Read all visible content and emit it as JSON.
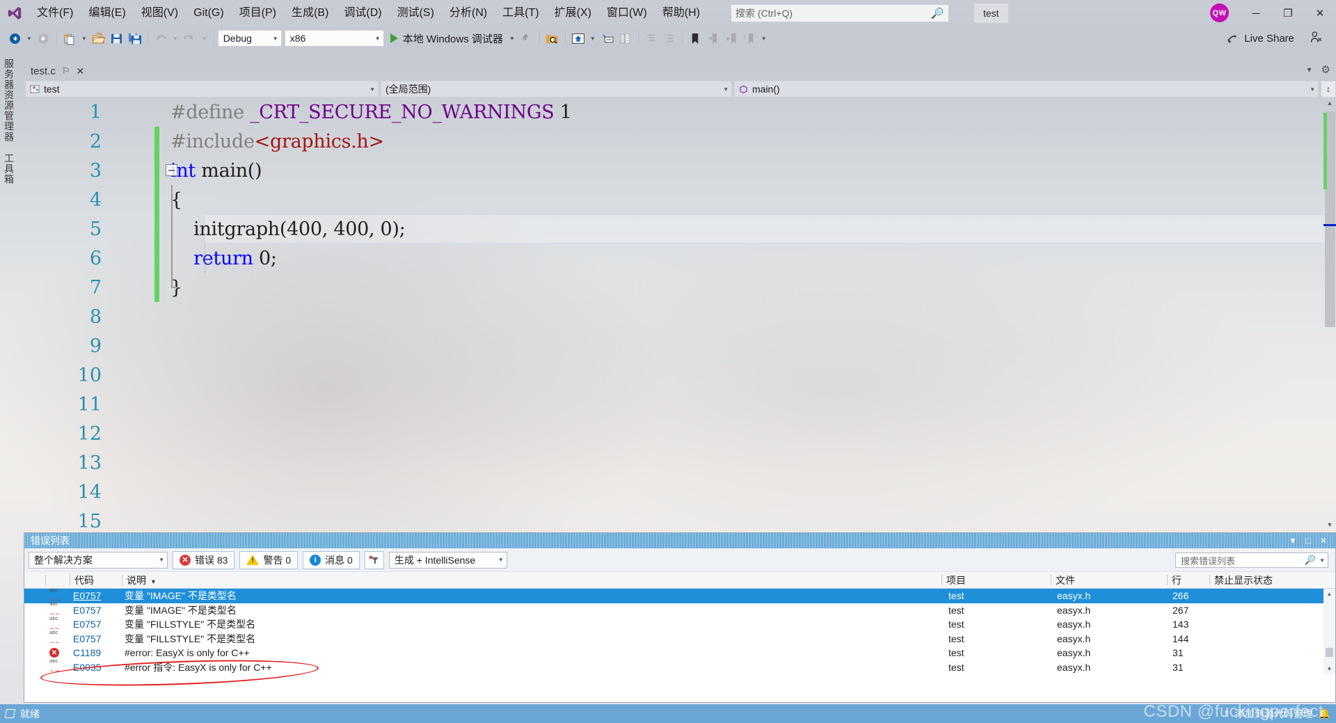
{
  "window": {
    "menu": [
      {
        "label": "文件(F)"
      },
      {
        "label": "编辑(E)"
      },
      {
        "label": "视图(V)"
      },
      {
        "label": "Git(G)"
      },
      {
        "label": "项目(P)"
      },
      {
        "label": "生成(B)"
      },
      {
        "label": "调试(D)"
      },
      {
        "label": "测试(S)"
      },
      {
        "label": "分析(N)"
      },
      {
        "label": "工具(T)"
      },
      {
        "label": "扩展(X)"
      },
      {
        "label": "窗口(W)"
      },
      {
        "label": "帮助(H)"
      }
    ],
    "search_placeholder": "搜索 (Ctrl+Q)",
    "solution_name": "test",
    "avatar_initials": "QW",
    "minimize": "─",
    "restore": "❐",
    "close": "✕"
  },
  "toolbar": {
    "config": "Debug",
    "platform": "x86",
    "run_label": "本地 Windows 调试器",
    "live_share": "Live Share"
  },
  "leftrail": {
    "server_explorer": "服务器资源管理器",
    "toolbox": "工具箱"
  },
  "tabstrip": {
    "document": "test.c",
    "pin_icon": "⚐",
    "close_icon": "✕",
    "overflow_icon": "▾",
    "settings_icon": "⚙"
  },
  "navbar": {
    "project_scope": "test",
    "member_scope": "(全局范围)",
    "function_scope": "main()"
  },
  "editor": {
    "lines": [
      {
        "no": "1",
        "changed": false,
        "tokens": [
          {
            "t": "#define ",
            "c": "k-pp"
          },
          {
            "t": "_CRT_SECURE_NO_WARNINGS",
            "c": "k-macro"
          },
          {
            "t": " 1",
            "c": "k-plain"
          }
        ]
      },
      {
        "no": "2",
        "changed": true,
        "tokens": [
          {
            "t": "#include",
            "c": "k-pp"
          },
          {
            "t": "<graphics.h>",
            "c": "k-str"
          }
        ]
      },
      {
        "no": "3",
        "changed": true,
        "tokens": [
          {
            "t": "int",
            "c": "k-kw"
          },
          {
            "t": " main()",
            "c": "k-plain"
          }
        ]
      },
      {
        "no": "4",
        "changed": true,
        "tokens": [
          {
            "t": "{",
            "c": "k-plain"
          }
        ]
      },
      {
        "no": "5",
        "changed": true,
        "tokens": [
          {
            "t": "    initgraph(400, 400, 0);",
            "c": "k-plain"
          }
        ]
      },
      {
        "no": "6",
        "changed": true,
        "tokens": [
          {
            "t": "    ",
            "c": "k-plain"
          },
          {
            "t": "return",
            "c": "k-kw"
          },
          {
            "t": " 0;",
            "c": "k-plain"
          }
        ]
      },
      {
        "no": "7",
        "changed": true,
        "tokens": [
          {
            "t": "}",
            "c": "k-plain"
          }
        ]
      },
      {
        "no": "8",
        "changed": false,
        "tokens": []
      },
      {
        "no": "9",
        "changed": false,
        "tokens": []
      },
      {
        "no": "10",
        "changed": false,
        "tokens": []
      },
      {
        "no": "11",
        "changed": false,
        "tokens": []
      },
      {
        "no": "12",
        "changed": false,
        "tokens": []
      },
      {
        "no": "13",
        "changed": false,
        "tokens": []
      },
      {
        "no": "14",
        "changed": false,
        "tokens": []
      },
      {
        "no": "15",
        "changed": false,
        "tokens": []
      }
    ],
    "fold_glyph": "─"
  },
  "error_list": {
    "title": "错误列表",
    "scope_filter": "整个解决方案",
    "error_label": "错误 83",
    "warning_label": "警告 0",
    "message_label": "消息 0",
    "build_filter": "生成 + IntelliSense",
    "search_placeholder": "搜索错误列表",
    "columns": {
      "code": "代码",
      "description": "说明",
      "project": "项目",
      "file": "文件",
      "line": "行",
      "suppression": "禁止显示状态"
    },
    "rows": [
      {
        "severity": "intellisense",
        "code": "E0757",
        "description": "变量 \"IMAGE\" 不是类型名",
        "project": "test",
        "file": "easyx.h",
        "line": "266",
        "suppression": "",
        "selected": true
      },
      {
        "severity": "intellisense",
        "code": "E0757",
        "description": "变量 \"IMAGE\" 不是类型名",
        "project": "test",
        "file": "easyx.h",
        "line": "267",
        "suppression": "",
        "selected": false
      },
      {
        "severity": "intellisense",
        "code": "E0757",
        "description": "变量 \"FILLSTYLE\" 不是类型名",
        "project": "test",
        "file": "easyx.h",
        "line": "143",
        "suppression": "",
        "selected": false
      },
      {
        "severity": "intellisense",
        "code": "E0757",
        "description": "变量 \"FILLSTYLE\" 不是类型名",
        "project": "test",
        "file": "easyx.h",
        "line": "144",
        "suppression": "",
        "selected": false
      },
      {
        "severity": "error",
        "code": "C1189",
        "description": "#error:  EasyX is only for C++",
        "project": "test",
        "file": "easyx.h",
        "line": "31",
        "suppression": "",
        "selected": false
      },
      {
        "severity": "intellisense",
        "code": "E0035",
        "description": "#error 指令:  EasyX is only for C++",
        "project": "test",
        "file": "easyx.h",
        "line": "31",
        "suppression": "",
        "selected": false
      }
    ]
  },
  "statusbar": {
    "ready": "就绪",
    "source_control": "添加到源代码管理",
    "watermark": "CSDN @fuckingperfect"
  }
}
